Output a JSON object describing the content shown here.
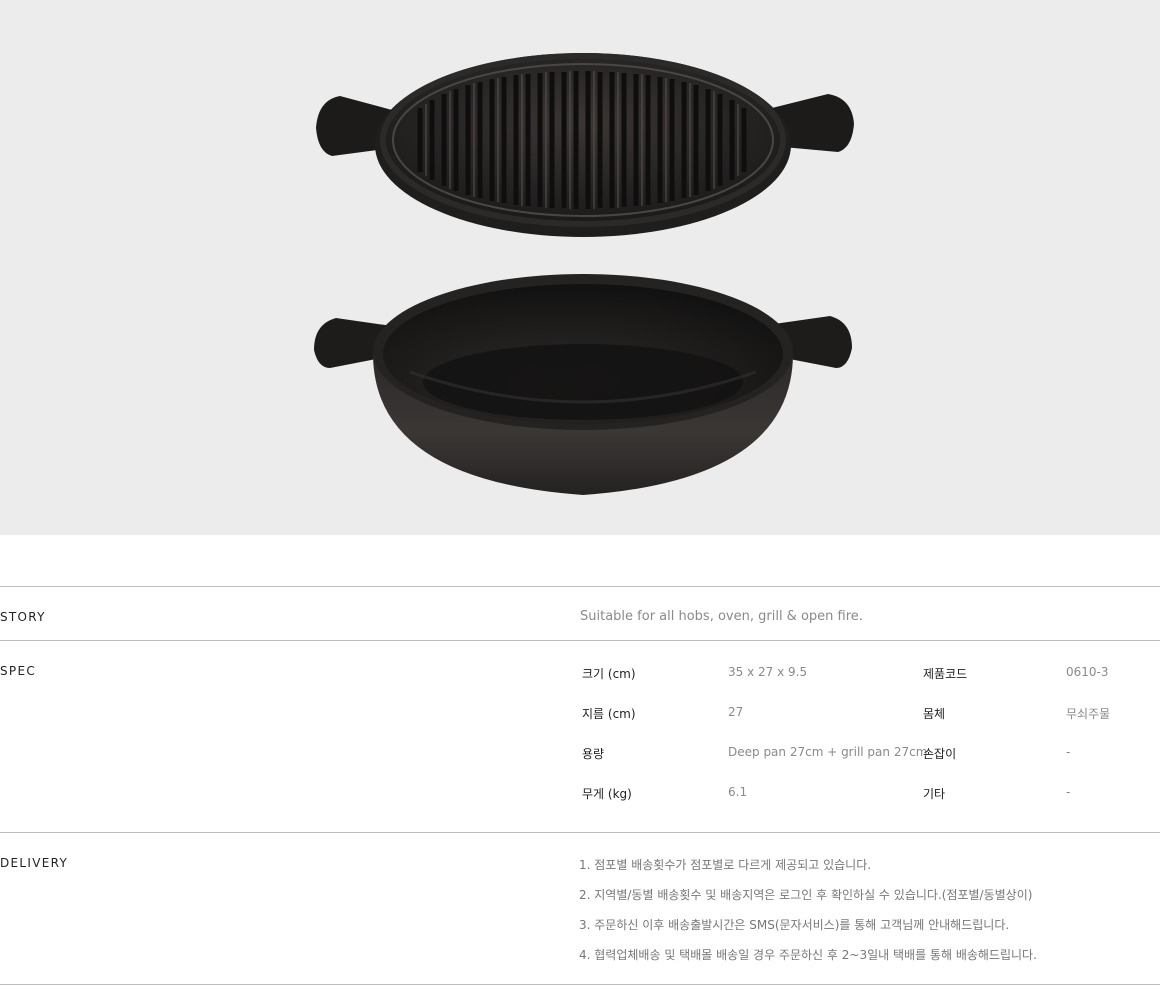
{
  "story": {
    "title": "STORY",
    "text": "Suitable for all hobs, oven, grill & open fire."
  },
  "spec": {
    "title": "SPEC",
    "rows": [
      {
        "label": "크기 (cm)",
        "value": "35 x 27 x 9.5",
        "label2": "제품코드",
        "value2": "0610-3"
      },
      {
        "label": "지름 (cm)",
        "value": "27",
        "label2": "몸체",
        "value2": "무쇠주물"
      },
      {
        "label": "용량",
        "value": "Deep pan 27cm + grill pan 27cm",
        "label2": "손잡이",
        "value2": "-"
      },
      {
        "label": "무게 (kg)",
        "value": "6.1",
        "label2": "기타",
        "value2": "-"
      }
    ]
  },
  "delivery": {
    "title": "DELIVERY",
    "items": [
      "1. 점포별 배송횟수가 점포별로 다르게 제공되고 있습니다.",
      "2. 지역별/동별 배송횟수 및 배송지역은 로그인 후 확인하실 수 있습니다.(점포별/동별상이)",
      "3. 주문하신 이후 배송출발시간은 SMS(문자서비스)를 통해 고객님께 안내해드립니다.",
      "4. 협력업체배송 및 택배몰 배송일 경우 주문하신 후 2~3일내 택배를 통해 배송해드립니다."
    ]
  },
  "colors": {
    "hero_background": "#ececec",
    "rule": "#bdbdbd",
    "value_text": "#8a8a8a"
  }
}
